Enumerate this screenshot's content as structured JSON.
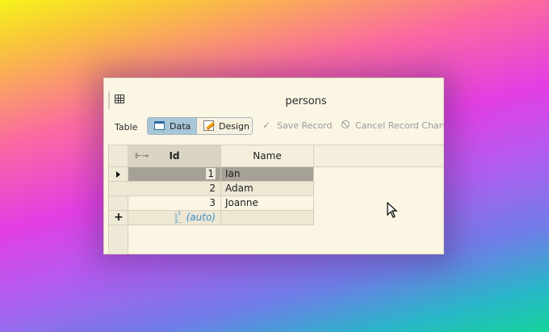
{
  "window": {
    "title": "persons"
  },
  "toolbar": {
    "table_label": "Table",
    "data_label": "Data",
    "design_label": "Design",
    "save_label": "Save Record",
    "cancel_label": "Cancel Record Change"
  },
  "grid": {
    "columns": [
      "Id",
      "Name"
    ],
    "rows": [
      {
        "id": "1",
        "name": "Ian"
      },
      {
        "id": "2",
        "name": "Adam"
      },
      {
        "id": "3",
        "name": "Joanne"
      }
    ],
    "new_row": {
      "marker": "+",
      "id_placeholder": "(auto)",
      "type_hint": "12\n3.."
    }
  },
  "icons": {
    "table": "table-icon",
    "data": "data-view-icon",
    "design": "design-view-icon",
    "save": "check-icon",
    "cancel": "cancel-icon",
    "key": "primary-key-icon",
    "current_row": "current-row-arrow-icon",
    "new_row": "plus-icon",
    "cursor": "mouse-pointer-icon"
  },
  "colors": {
    "window_bg": "#fbf5e4",
    "selected_segment": "#a7c6d6",
    "selected_row": "#a5a197",
    "auto_text": "#3d8ec9"
  }
}
